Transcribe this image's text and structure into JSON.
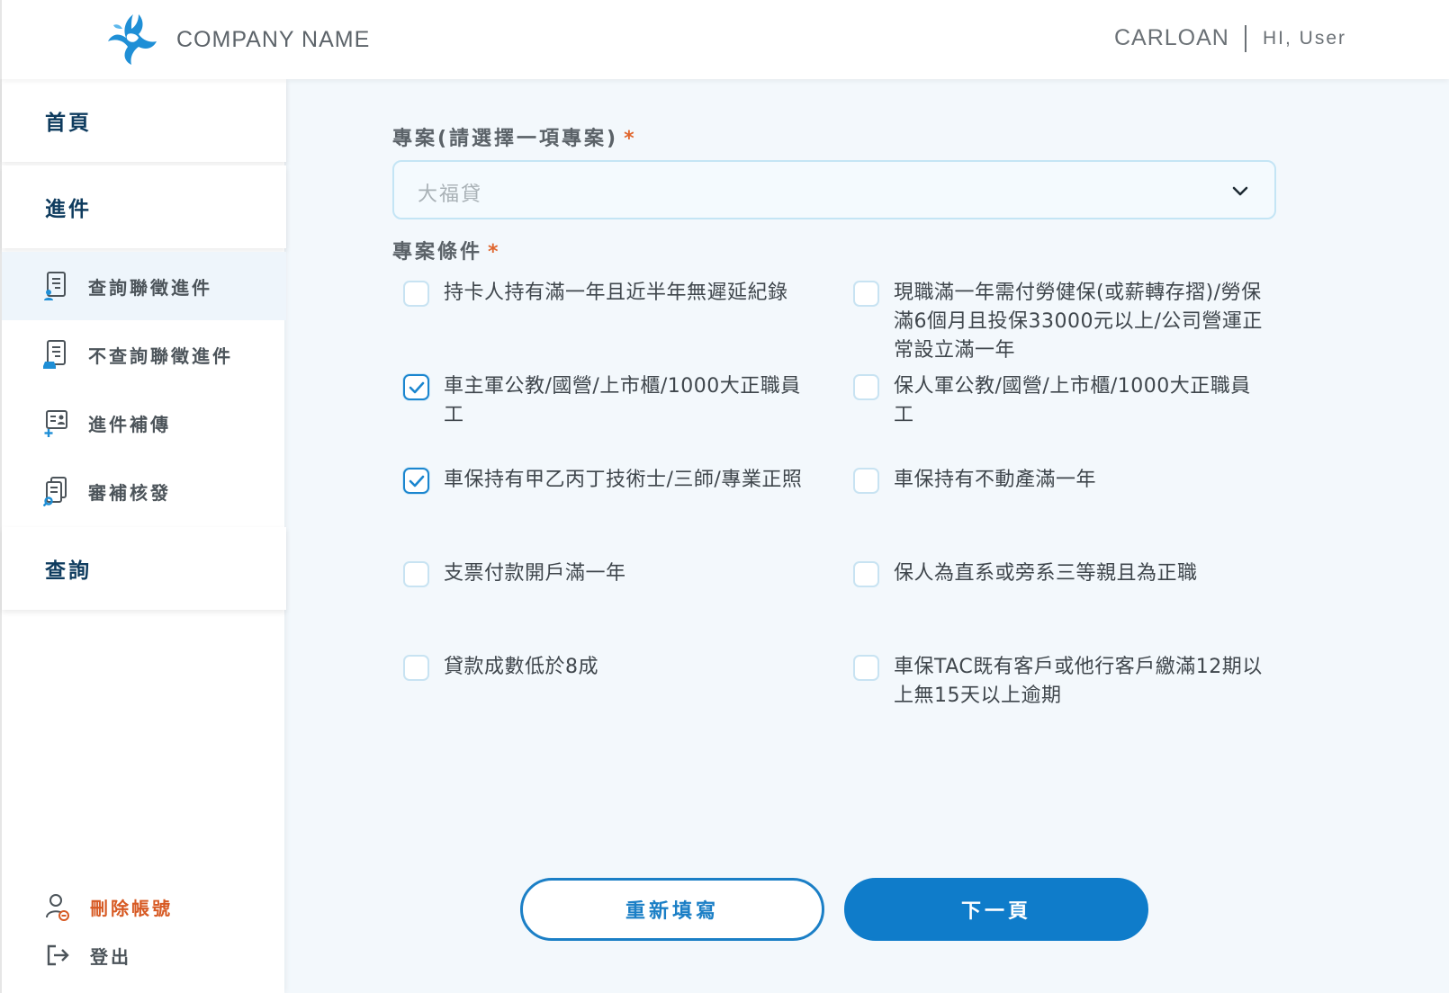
{
  "header": {
    "company_name": "COMPANY NAME",
    "app_name": "CARLOAN",
    "greeting": "HI, User"
  },
  "sidebar": {
    "sections": [
      {
        "label": "首頁"
      },
      {
        "label": "進件"
      },
      {
        "label": "查詢"
      }
    ],
    "sub_items": [
      {
        "label": "查詢聯徵進件",
        "icon": "document-person-icon",
        "active": true
      },
      {
        "label": "不查詢聯徵進件",
        "icon": "document-car-icon",
        "active": false
      },
      {
        "label": "進件補傳",
        "icon": "id-card-plus-icon",
        "active": false
      },
      {
        "label": "審補核發",
        "icon": "documents-search-icon",
        "active": false
      }
    ],
    "delete_account": "刪除帳號",
    "logout": "登出"
  },
  "form": {
    "project_label": "專案(請選擇一項專案)",
    "required_mark": "*",
    "project_value": "大福貸",
    "conditions_label": "專案條件",
    "conditions": [
      {
        "text": "持卡人持有滿一年且近半年無遲延紀錄",
        "checked": false
      },
      {
        "text": "現職滿一年需付勞健保(或薪轉存摺)/勞保滿6個月且投保33000元以上/公司營運正常設立滿一年",
        "checked": false
      },
      {
        "text": "車主軍公教/國營/上市櫃/1000大正職員工",
        "checked": true
      },
      {
        "text": "保人軍公教/國營/上市櫃/1000大正職員工",
        "checked": false
      },
      {
        "text": "車保持有甲乙丙丁技術士/三師/專業正照",
        "checked": true
      },
      {
        "text": "車保持有不動產滿一年",
        "checked": false
      },
      {
        "text": "支票付款開戶滿一年",
        "checked": false
      },
      {
        "text": "保人為直系或旁系三等親且為正職",
        "checked": false
      },
      {
        "text": "貸款成數低於8成",
        "checked": false
      },
      {
        "text": "車保TAC既有客戶或他行客戶繳滿12期以上無15天以上逾期",
        "checked": false
      }
    ]
  },
  "buttons": {
    "reset": "重新填寫",
    "next": "下一頁"
  },
  "colors": {
    "primary": "#0f7cca",
    "nav_text": "#0e3b5e",
    "danger": "#d75a24",
    "required": "#e0662e"
  }
}
